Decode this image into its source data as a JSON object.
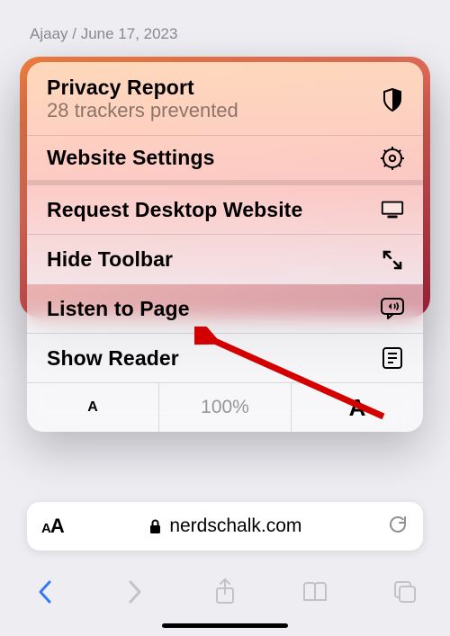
{
  "byline": {
    "author": "Ajaay",
    "sep": " / ",
    "date": "June 17, 2023"
  },
  "menu": {
    "privacy": {
      "title": "Privacy Report",
      "subtitle": "28 trackers prevented"
    },
    "settings": "Website Settings",
    "desktop": "Request Desktop Website",
    "hide_toolbar": "Hide Toolbar",
    "listen": "Listen to Page",
    "reader": "Show Reader",
    "zoom": {
      "small": "A",
      "pct": "100%",
      "big": "A"
    }
  },
  "urlbar": {
    "aa_small": "A",
    "aa_big": "A",
    "domain": "nerdschalk.com"
  },
  "toolbar": {}
}
